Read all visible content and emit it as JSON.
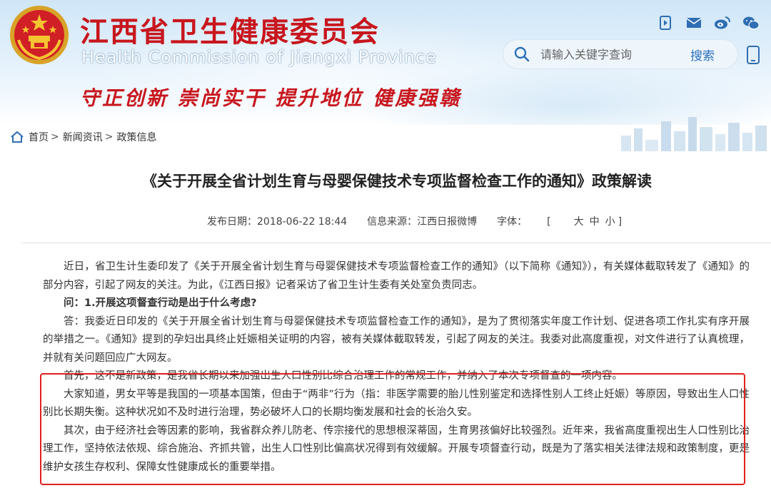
{
  "header": {
    "title": "江西省卫生健康委员会",
    "subtitle": "Health Commission of Jiangxi Province",
    "slogan": "守正创新  崇尚实干    提升地位  健康强赣",
    "icons": [
      "video-icon",
      "mail-icon",
      "weibo-icon",
      "wechat-icon",
      "mobile-icon"
    ],
    "search": {
      "placeholder": "请输入关键字查询",
      "button_label": "搜索"
    }
  },
  "breadcrumb": {
    "items": [
      "首页",
      "新闻资讯",
      "政策信息"
    ],
    "separator": ">"
  },
  "article": {
    "title": "《关于开展全省计划生育与母婴保健技术专项监督检查工作的通知》政策解读",
    "publish_date_label": "发布日期：2018-06-22 18:44",
    "source_label": "信息来源：江西日报微博",
    "font_size_label": "字体：",
    "font_size_open": "[",
    "font_size_options": [
      "大",
      "中",
      "小"
    ],
    "font_size_close": "]",
    "paragraphs": [
      "近日，省卫生计生委印发了《关于开展全省计划生育与母婴保健技术专项监督检查工作的通知》（以下简称《通知》），有关媒体截取转发了《通知》的部分内容，引起了网友的关注。为此，《江西日报》记者采访了省卫生计生委有关处室负责同志。",
      "问：1.开展这项督查行动是出于什么考虑?",
      "答：我委近日印发的《关于开展全省计划生育与母婴保健技术专项监督检查工作的通知》，是为了贯彻落实年度工作计划、促进各项工作扎实有序开展的举措之一。《通知》提到的孕妇出具终止妊娠相关证明的内容，被有关媒体截取转发，引起了网友的关注。我委对此高度重视，对文件进行了认真梳理，并就有关问题回应广大网友。",
      "首先，这不是新政策，是我省长期以来加强出生人口性别比综合治理工作的常规工作，并纳入了本次专项督查的一项内容。",
      "大家知道，男女平等是我国的一项基本国策，但由于“两非”行为（指：非医学需要的胎儿性别鉴定和选择性别人工终止妊娠）等原因，导致出生人口性别比长期失衡。这种状况如不及时进行治理，势必破坏人口的长期均衡发展和社会的长治久安。",
      "其次，由于经济社会等因素的影响，我省群众养儿防老、传宗接代的思想根深蒂固，生育男孩偏好比较强烈。近年来，我省高度重视出生人口性别比治理工作，坚持依法依规、综合施治、齐抓共管，出生人口性别比偏高状况得到有效缓解。开展专项督查行动，既是为了落实相关法律法规和政策制度，更是维护女孩生存权利、保障女性健康成长的重要举措。"
    ]
  },
  "colors": {
    "brand_red": "#c8161d",
    "highlight_border": "#e0201c",
    "link_blue": "#2a6fba"
  }
}
